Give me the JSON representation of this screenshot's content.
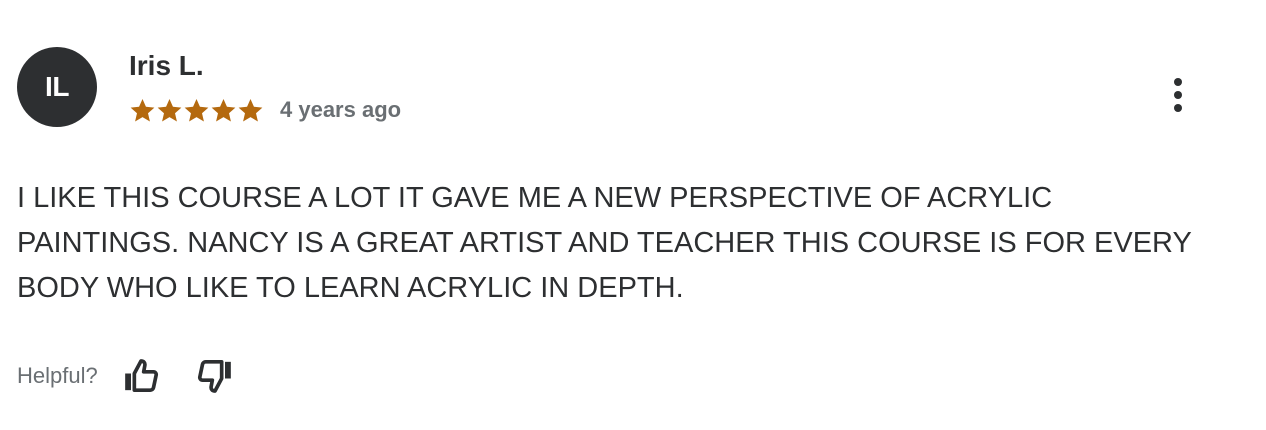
{
  "reviewer": {
    "initials": "IL",
    "name": "Iris L."
  },
  "rating": {
    "stars": 5,
    "max": 5,
    "color": "#b4690e",
    "icon": "star-icon"
  },
  "date": "4 years ago",
  "more_menu_icon": "more-vertical-icon",
  "content": "I LIKE THIS COURSE A LOT IT GAVE ME A NEW PERSPECTIVE OF ACRYLIC PAINTINGS. NANCY IS A GREAT ARTIST AND TEACHER THIS COURSE IS FOR EVERY BODY WHO LIKE TO LEARN ACRYLIC IN DEPTH.",
  "feedback": {
    "label": "Helpful?",
    "thumbs_up_icon": "thumbs-up-icon",
    "thumbs_down_icon": "thumbs-down-icon"
  },
  "colors": {
    "text_primary": "#2d2f31",
    "text_secondary": "#6a6f73",
    "avatar_bg": "#2d2f31"
  }
}
